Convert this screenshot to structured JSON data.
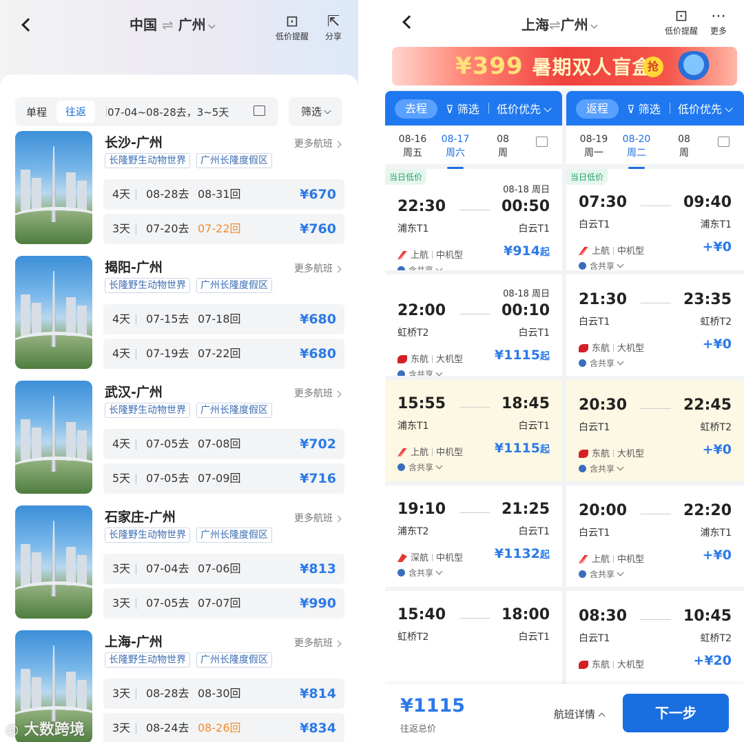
{
  "left": {
    "header": {
      "from": "中国",
      "to": "广州",
      "arrow": "⇌",
      "alert_label": "低价提醒",
      "share_label": "分享"
    },
    "segment": {
      "oneway": "单程",
      "roundtrip": "往返",
      "dates": "07-04~08-28去，3~5天"
    },
    "filter_label": "筛选",
    "more_label": "更多航班",
    "tags": [
      "长隆野生动物世界",
      "广州长隆度假区"
    ],
    "cards": [
      {
        "route": "长沙-广州",
        "rows": [
          {
            "days": "4天",
            "go": "08-28去",
            "ret": "08-31回",
            "ret_orange": false,
            "price": "¥670"
          },
          {
            "days": "3天",
            "go": "07-20去",
            "ret": "07-22回",
            "ret_orange": true,
            "price": "¥760"
          }
        ]
      },
      {
        "route": "揭阳-广州",
        "rows": [
          {
            "days": "4天",
            "go": "07-15去",
            "ret": "07-18回",
            "ret_orange": false,
            "price": "¥680"
          },
          {
            "days": "4天",
            "go": "07-19去",
            "ret": "07-22回",
            "ret_orange": false,
            "price": "¥680"
          }
        ]
      },
      {
        "route": "武汉-广州",
        "rows": [
          {
            "days": "4天",
            "go": "07-05去",
            "ret": "07-08回",
            "ret_orange": false,
            "price": "¥702"
          },
          {
            "days": "5天",
            "go": "07-05去",
            "ret": "07-09回",
            "ret_orange": false,
            "price": "¥716"
          }
        ]
      },
      {
        "route": "石家庄-广州",
        "rows": [
          {
            "days": "3天",
            "go": "07-04去",
            "ret": "07-06回",
            "ret_orange": false,
            "price": "¥813"
          },
          {
            "days": "3天",
            "go": "07-05去",
            "ret": "07-07回",
            "ret_orange": false,
            "price": "¥990"
          }
        ]
      },
      {
        "route": "上海-广州",
        "rows": [
          {
            "days": "3天",
            "go": "08-28去",
            "ret": "08-30回",
            "ret_orange": false,
            "price": "¥814"
          },
          {
            "days": "3天",
            "go": "08-24去",
            "ret": "08-26回",
            "ret_orange": true,
            "price": "¥834"
          }
        ]
      }
    ],
    "watermark": "大数跨境"
  },
  "right": {
    "header": {
      "from": "上海",
      "to": "广州",
      "arrow": "⇌",
      "alert_label": "低价提醒",
      "more_label": "更多"
    },
    "banner": {
      "price": "¥399",
      "text": "暑期双人盲盒",
      "grab": "抢"
    },
    "outbound": {
      "pill": "去程",
      "filter": "筛选",
      "sort": "低价优先",
      "dates": [
        {
          "date": "08-16",
          "day": "周五"
        },
        {
          "date": "08-17",
          "day": "周六"
        },
        {
          "date": "08",
          "day": "周"
        }
      ],
      "badge": "当日低价",
      "flights": [
        {
          "dep": "22:30",
          "arr": "00:50",
          "dep_ap": "浦东T1",
          "arr_ap": "白云T1",
          "next_day": "08-18 周日",
          "airline": "上航",
          "plane": "中机型",
          "price": "¥914",
          "suffix": "起",
          "share": "含共享",
          "logo": "red",
          "hl": false
        },
        {
          "dep": "22:00",
          "arr": "00:10",
          "dep_ap": "虹桥T2",
          "arr_ap": "白云T1",
          "next_day": "08-18 周日",
          "airline": "东航",
          "plane": "大机型",
          "price": "¥1115",
          "suffix": "起",
          "share": "含共享",
          "logo": "east",
          "hl": false
        },
        {
          "dep": "15:55",
          "arr": "18:45",
          "dep_ap": "浦东T1",
          "arr_ap": "白云T1",
          "next_day": "",
          "airline": "上航",
          "plane": "中机型",
          "price": "¥1115",
          "suffix": "起",
          "share": "含共享",
          "logo": "red",
          "hl": true
        },
        {
          "dep": "19:10",
          "arr": "21:25",
          "dep_ap": "浦东T2",
          "arr_ap": "白云T1",
          "next_day": "",
          "airline": "深航",
          "plane": "中机型",
          "price": "¥1132",
          "suffix": "起",
          "share": "含共享",
          "logo": "sz",
          "hl": false
        },
        {
          "dep": "15:40",
          "arr": "18:00",
          "dep_ap": "虹桥T2",
          "arr_ap": "白云T1",
          "next_day": "",
          "airline": "",
          "plane": "",
          "price": "",
          "suffix": "",
          "share": "",
          "logo": "",
          "hl": false
        }
      ]
    },
    "return": {
      "pill": "返程",
      "filter": "筛选",
      "sort": "低价优先",
      "dates": [
        {
          "date": "08-19",
          "day": "周一"
        },
        {
          "date": "08-20",
          "day": "周二"
        },
        {
          "date": "08",
          "day": "周"
        }
      ],
      "badge": "当日低价",
      "flights": [
        {
          "dep": "07:30",
          "arr": "09:40",
          "dep_ap": "白云T1",
          "arr_ap": "浦东T1",
          "airline": "上航",
          "plane": "中机型",
          "price": "+¥0",
          "share": "含共享",
          "logo": "red",
          "hl": false
        },
        {
          "dep": "21:30",
          "arr": "23:35",
          "dep_ap": "白云T1",
          "arr_ap": "虹桥T2",
          "airline": "东航",
          "plane": "大机型",
          "price": "+¥0",
          "share": "含共享",
          "logo": "east",
          "hl": false
        },
        {
          "dep": "20:30",
          "arr": "22:45",
          "dep_ap": "白云T1",
          "arr_ap": "虹桥T2",
          "airline": "东航",
          "plane": "大机型",
          "price": "+¥0",
          "share": "含共享",
          "logo": "east",
          "hl": true
        },
        {
          "dep": "20:00",
          "arr": "22:20",
          "dep_ap": "白云T1",
          "arr_ap": "浦东T1",
          "airline": "上航",
          "plane": "中机型",
          "price": "+¥0",
          "share": "含共享",
          "logo": "red",
          "hl": false
        },
        {
          "dep": "08:30",
          "arr": "10:45",
          "dep_ap": "白云T1",
          "arr_ap": "虹桥T2",
          "airline": "东航",
          "plane": "大机型",
          "price": "+¥20",
          "share": "",
          "logo": "east",
          "hl": false
        }
      ]
    },
    "bottom": {
      "total": "¥1115",
      "total_label": "往返总价",
      "details": "航班详情",
      "next": "下一步"
    }
  }
}
